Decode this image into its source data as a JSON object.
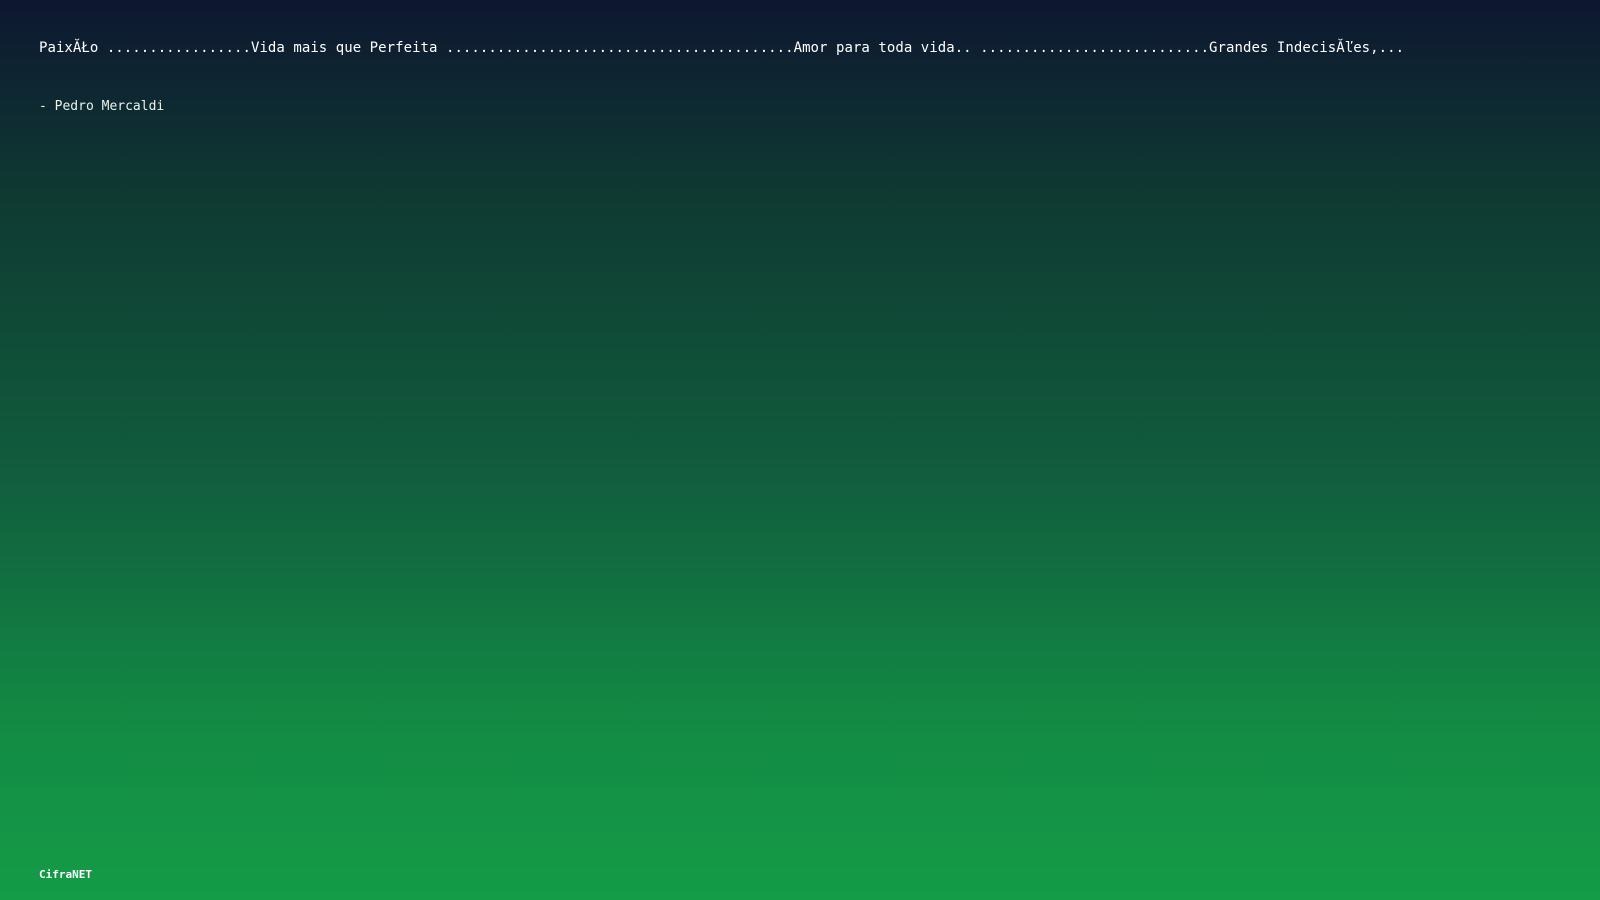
{
  "quote": {
    "text": "PaixĂŁo .................Vida mais que Perfeita .........................................Amor para toda vida.. ...........................Grandes IndecisĂľes,...",
    "author": "- Pedro Mercaldi"
  },
  "footer": {
    "brand": "CifraNET"
  }
}
